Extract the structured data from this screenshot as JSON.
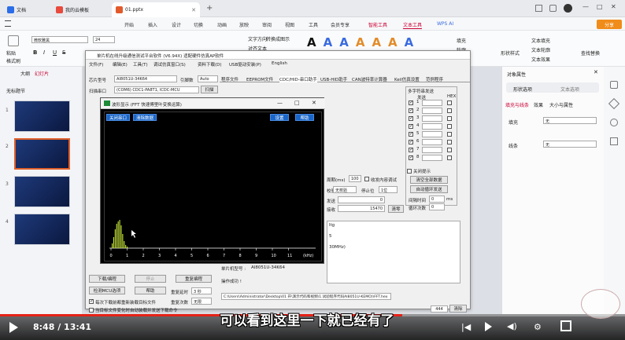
{
  "browser_tabs": [
    {
      "label": "文档",
      "active": false
    },
    {
      "label": "我的云模板",
      "active": false
    },
    {
      "label": "01.pptx",
      "active": true
    }
  ],
  "new_tab": "+",
  "window_controls": {
    "minimize": "—",
    "maximize": "□",
    "close": "✕"
  },
  "menu": [
    "开始",
    "插入",
    "设计",
    "切换",
    "动画",
    "放映",
    "审阅",
    "视图",
    "工具",
    "会员专享",
    "智能工具",
    "文本工具"
  ],
  "wps_ai": "WPS AI",
  "share": "分享",
  "ribbon": {
    "paste": "粘贴",
    "format_painter": "格式刷",
    "font_name": "微软雅黑",
    "font_size": "24",
    "bold": "B",
    "italic": "I",
    "underline": "U",
    "strike": "S",
    "text_direction": "文字方向",
    "align_text": "对齐文本",
    "convert_smartart": "转换成图示",
    "fill": "填充",
    "outline": "轮廓",
    "shape_style": "形状样式",
    "text_fill": "文本填充",
    "text_outline": "文本轮廓",
    "text_effect": "文本效果",
    "find_replace": "查找替换"
  },
  "slides_panel": {
    "tab_outline": "大纲",
    "tab_slides": "幻灯片",
    "section": "无标题节",
    "numbers": [
      "1",
      "2",
      "3",
      "4"
    ]
  },
  "serial_window": {
    "title": "单片机在线升级通信测试平台软件 (V6.94X) 适配硬件仿真AP软件",
    "menu": [
      "文件(F)",
      "编辑(E)",
      "工具(T)",
      "调试仿真窗口(S)",
      "资料下载(D)",
      "USB驱动安装(P)",
      "English"
    ],
    "mcu_label": "芯片型号",
    "mcu_value": "AI8051U-34K64",
    "pin_label": "引脚数",
    "pin_value": "Auto",
    "port_label": "扫描串口",
    "port_value": "(COM6) CDC1-PA8T1, ICDC-MCU",
    "scan_btn": "扫描",
    "tabs": [
      "程序文件",
      "EEPROM文件",
      "CDC/HID-串口助手",
      "USB-HID助手",
      "CAN波特率计算器",
      "Keil仿真设置",
      "范例程序"
    ],
    "multi_send_title": "多字符串发送",
    "multi_send_cols": [
      "发送",
      "HEX"
    ],
    "multi_send_rows": [
      "1",
      "2",
      "3",
      "4",
      "5",
      "6",
      "7",
      "8"
    ],
    "close_prompt": "关闭提示",
    "clear_all": "清空全部数据",
    "auto_loop": "自动循环发送",
    "interval_label": "间隔时间",
    "interval_value": "0",
    "interval_unit": "ms",
    "loop_count_label": "循环次数",
    "loop_count_value": "0",
    "period_label": "周期(ms)",
    "period_value": "100",
    "recv_buffer": "收发内容调试",
    "parity_label": "校验位",
    "parity_value": "无校验",
    "stop_label": "停止位",
    "stop_value": "1位",
    "send_label": "发送",
    "send_value": "0",
    "recv_label": "接收",
    "recv_value": "15470",
    "clear_btn": "清零",
    "mcu_model_label": "单片机型号 :",
    "mcu_model_value": "AI8051U-34K64",
    "op_label": "操作成功 !",
    "log_lines": [
      "ltg",
      "5",
      "",
      "30MHz)"
    ],
    "download_btn": "下载/编程",
    "stop_btn": "停止",
    "reprogram_btn": "重复编程",
    "check_mcu_btn": "检测MCU选项",
    "help_btn": "帮助",
    "repeat_delay_label": "重复延时",
    "repeat_delay_value": "3 秒",
    "repeat_count_label": "重复次数",
    "repeat_count_value": "无限",
    "opt1": "每次下载前都重新装载目标文件",
    "opt2": "当目标文件变化时自动装载并发送下载命令",
    "path": "C:\\Users\\Administrator\\Desktop\\01 开\\演示代码和视频\\1.试验程序代码AI8051U-KEMO)\\FFT.hex",
    "status_count": "444",
    "status_clear": "清除"
  },
  "fft_window": {
    "title": "波形显示 (FFT 快速傅里叶变换运算)",
    "btn_close_port": "关闭串口",
    "btn_clear": "清除数据",
    "btn_settings": "设置",
    "btn_help": "帮助",
    "x_ticks": [
      "0",
      "1",
      "2",
      "3",
      "4",
      "5",
      "6",
      "7",
      "8",
      "9",
      "10",
      "11"
    ],
    "x_unit": "(kHz)"
  },
  "right_panel": {
    "title": "对象属性",
    "tab_shape": "形状选项",
    "tab_text": "文本选项",
    "subtabs": [
      "填充与线条",
      "效果",
      "大小与属性"
    ],
    "fill_label": "填充",
    "fill_value": "无",
    "line_label": "线条",
    "line_value": "无"
  },
  "player": {
    "time": "8:48 / 13:41",
    "progress": 0.643,
    "subtitle": "可以看到这里一下就已经有了"
  }
}
